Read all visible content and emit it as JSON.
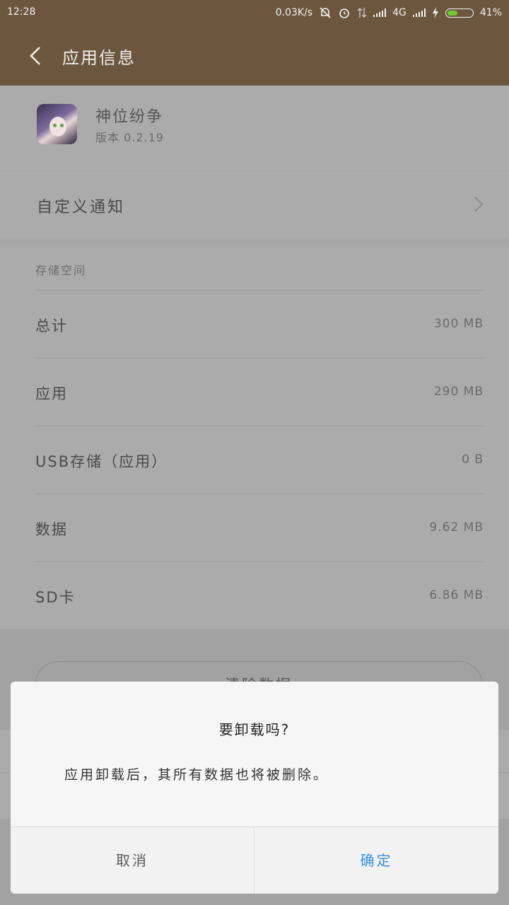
{
  "status_bar": {
    "time": "12:28",
    "net_speed": "0.03K/s",
    "network": "4G",
    "battery": "41%",
    "battery_level": 0.41
  },
  "app_bar": {
    "title": "应用信息"
  },
  "app": {
    "name": "神位纷争",
    "version": "版本 0.2.19"
  },
  "notify": {
    "label": "自定义通知"
  },
  "storage": {
    "header": "存储空间",
    "rows": [
      {
        "label": "总计",
        "value": "300 MB"
      },
      {
        "label": "应用",
        "value": "290 MB"
      },
      {
        "label": "USB存储（应用）",
        "value": "0 B"
      },
      {
        "label": "数据",
        "value": "9.62 MB"
      },
      {
        "label": "SD卡",
        "value": "6.86 MB"
      }
    ]
  },
  "clear_button": {
    "label": "清除数据"
  },
  "dialog": {
    "title": "要卸载吗?",
    "message": "应用卸载后，其所有数据也将被删除。",
    "cancel": "取消",
    "ok": "确定"
  },
  "colors": {
    "header": "#6c573e",
    "accent": "#3a8fd8",
    "battery": "#6ecb2c"
  }
}
